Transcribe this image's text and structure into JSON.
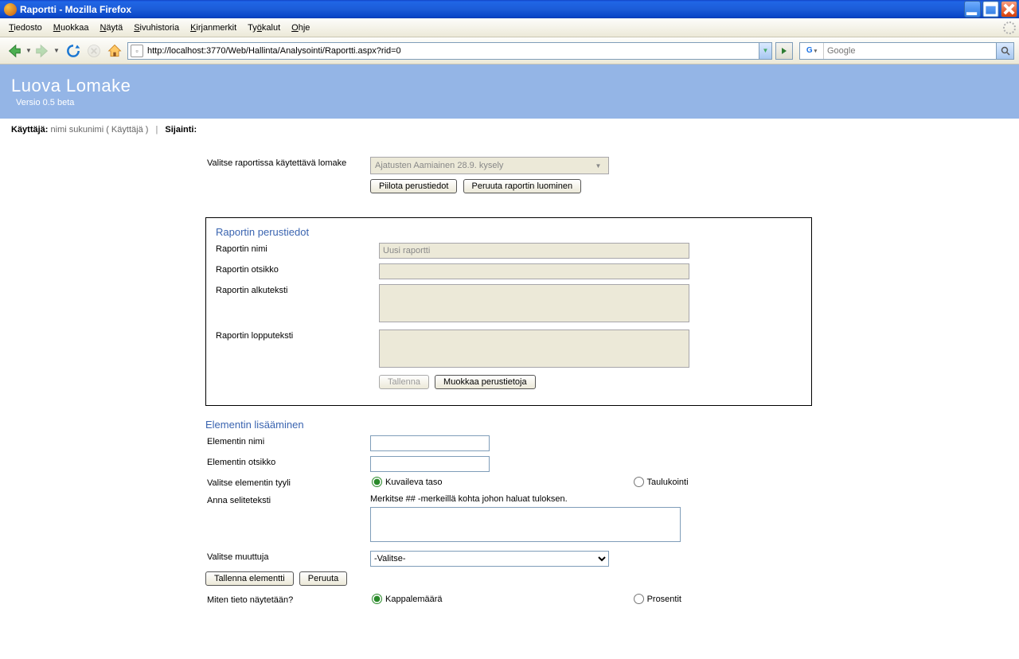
{
  "window": {
    "title": "Raportti - Mozilla Firefox"
  },
  "menu": {
    "items": [
      "Tiedosto",
      "Muokkaa",
      "Näytä",
      "Sivuhistoria",
      "Kirjanmerkit",
      "Työkalut",
      "Ohje"
    ]
  },
  "toolbar": {
    "url": "http://localhost:3770/Web/Hallinta/Analysointi/Raportti.aspx?rid=0",
    "search_placeholder": "Google"
  },
  "header": {
    "title": "Luova Lomake",
    "version": "Versio 0.5 beta"
  },
  "infostrip": {
    "user_label": "Käyttäjä:",
    "user_value": "nimi sukunimi ( Käyttäjä )",
    "sep": "|",
    "location_label": "Sijainti:"
  },
  "form_select": {
    "label": "Valitse raportissa käytettävä lomake",
    "value": "Ajatusten Aamiainen 28.9. kysely",
    "btn_hide": "Piilota perustiedot",
    "btn_cancel": "Peruuta raportin luominen"
  },
  "basics": {
    "title": "Raportin perustiedot",
    "name_label": "Raportin nimi",
    "name_value": "Uusi raportti",
    "title_label": "Raportin otsikko",
    "intro_label": "Raportin alkuteksti",
    "outro_label": "Raportin lopputeksti",
    "btn_save": "Tallenna",
    "btn_edit": "Muokkaa perustietoja"
  },
  "element": {
    "title": "Elementin lisääminen",
    "name_label": "Elementin nimi",
    "title_label": "Elementin otsikko",
    "style_label": "Valitse elementin tyyli",
    "style_opt1": "Kuvaileva taso",
    "style_opt2": "Taulukointi",
    "legend_label": "Anna seliteteksti",
    "legend_hint": "Merkitse ## -merkeillä kohta johon haluat tuloksen.",
    "var_label": "Valitse muuttuja",
    "var_value": "-Valitse-",
    "btn_save": "Tallenna elementti",
    "btn_cancel": "Peruuta",
    "display_label": "Miten tieto näytetään?",
    "display_opt1": "Kappalemäärä",
    "display_opt2": "Prosentit"
  }
}
